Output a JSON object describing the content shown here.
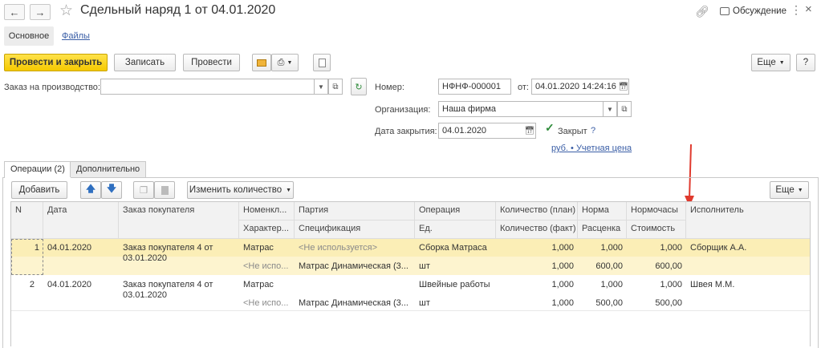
{
  "window": {
    "title": "Сдельный наряд 1 от 04.01.2020",
    "discussion": "Обсуждение",
    "icons": [
      "back-arrow",
      "forward-arrow",
      "star",
      "link",
      "comment",
      "more",
      "close"
    ]
  },
  "sections": {
    "main": "Основное",
    "files": "Файлы"
  },
  "toolbar": {
    "post_close": "Провести и закрыть",
    "save": "Записать",
    "post": "Провести",
    "more": "Еще",
    "help": "?"
  },
  "form": {
    "order_label": "Заказ на производство:",
    "order_value": "",
    "number_label": "Номер:",
    "number_value": "НФНФ-000001",
    "date_from_label": "от:",
    "date_from_value": "04.01.2020 14:24:16",
    "org_label": "Организация:",
    "org_value": "Наша фирма",
    "close_date_label": "Дата закрытия:",
    "close_date_value": "04.01.2020",
    "closed_label": "Закрыт",
    "closed_help": "?",
    "currency_link": "руб. • Учетная цена"
  },
  "tabs": [
    "Операции (2)",
    "Дополнительно"
  ],
  "grid_toolbar": {
    "add": "Добавить",
    "change_qty": "Изменить количество",
    "more": "Еще"
  },
  "grid": {
    "headers_top": [
      "N",
      "Дата",
      "Заказ покупателя",
      "Номенкл...",
      "Партия",
      "Операция",
      "Количество (план)",
      "Норма",
      "Нормочасы",
      "Исполнитель"
    ],
    "headers_bottom": [
      "Характер...",
      "Спецификация",
      "Ед.",
      "Количество (факт)",
      "Расценка",
      "Стоимость"
    ],
    "rows": [
      {
        "n": "1",
        "date": "04.01.2020",
        "order_line1": "Заказ покупателя 4 от",
        "order_line2": "03.01.2020",
        "nomen": "Матрас",
        "party": "<Не используется>",
        "operation": "Сборка Матраса",
        "qty_plan": "1,000",
        "norm": "1,000",
        "norm_hours": "1,000",
        "executor": "Сборщик А.А.",
        "character": "<Не испо...",
        "spec": "Матрас Динамическая (3...",
        "unit": "шт",
        "qty_fact": "1,000",
        "rate": "600,00",
        "cost": "600,00",
        "selected": true
      },
      {
        "n": "2",
        "date": "04.01.2020",
        "order_line1": "Заказ покупателя 4 от",
        "order_line2": "03.01.2020",
        "nomen": "Матрас",
        "party": "",
        "operation": "Швейные работы",
        "qty_plan": "1,000",
        "norm": "1,000",
        "norm_hours": "1,000",
        "executor": "Швея М.М.",
        "character": "<Не испо...",
        "spec": "Матрас Динамическая (3...",
        "unit": "шт",
        "qty_fact": "1,000",
        "rate": "500,00",
        "cost": "500,00",
        "selected": false
      }
    ]
  },
  "colors": {
    "primary_button": "#f5c900",
    "selected_row": "#fbeeb6",
    "selected_row_alt": "#fdf4cf",
    "annotation_arrow": "#e03a2e",
    "link": "#3a5ea6",
    "check": "#2e8b3a"
  }
}
